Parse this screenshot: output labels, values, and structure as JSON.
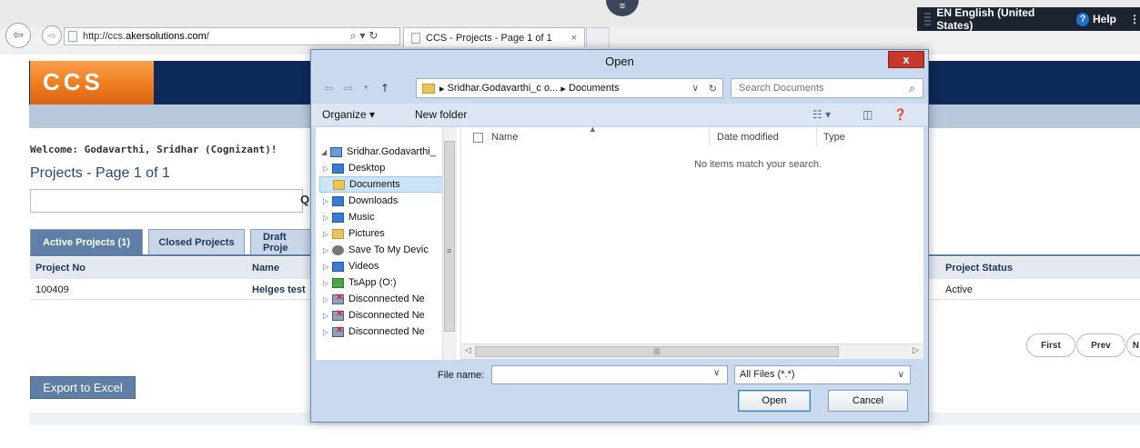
{
  "browser": {
    "address_prefix": "http://ccs.",
    "address_host": "akersolutions.com",
    "address_suffix": "/",
    "address_tools": "⌕ ▾ ↻",
    "tab_title": "CCS - Projects - Page 1 of 1",
    "tab_close": "×",
    "language": "EN English (United States)",
    "help_label": "Help",
    "help_icon": "?",
    "menu_dots": "⋮"
  },
  "app": {
    "logo": "CCS",
    "welcome_label": "Welcome:",
    "welcome_user": "Godavarthi, Sridhar (Cognizant)!",
    "page_title": "Projects - Page 1 of 1",
    "search_icon_glyph": "Q",
    "tabs": [
      {
        "label": "Active Projects (1)"
      },
      {
        "label": "Closed Projects"
      },
      {
        "label": "Draft Proje"
      }
    ],
    "table": {
      "headers": [
        "Project No",
        "Name",
        "Project Status"
      ],
      "rows": [
        {
          "project_no": "100409",
          "name": "Helges test",
          "status": "Active"
        }
      ]
    },
    "pager": [
      "First",
      "Prev",
      "N"
    ],
    "export_label": "Export to Excel"
  },
  "dialog": {
    "title": "Open",
    "close_label": "x",
    "path_user": "Sridhar.Godavarthi_c o...",
    "path_folder": "Documents",
    "path_sep": "▸",
    "search_placeholder": "Search Documents",
    "organize_label": "Organize ▾",
    "new_folder_label": "New folder",
    "tree": [
      {
        "label": "Sridhar.Godavarthi_",
        "icon": "pc-icon",
        "arrow": "◢"
      },
      {
        "label": "Desktop",
        "icon": "folder-blue-icon",
        "arrow": "▷"
      },
      {
        "label": "Documents",
        "icon": "folder-icon",
        "arrow": ""
      },
      {
        "label": "Downloads",
        "icon": "download-folder-icon",
        "arrow": "▷"
      },
      {
        "label": "Music",
        "icon": "music-folder-icon",
        "arrow": "▷"
      },
      {
        "label": "Pictures",
        "icon": "pictures-folder-icon",
        "arrow": "▷"
      },
      {
        "label": "Save To My Devic",
        "icon": "device-icon",
        "arrow": "▷"
      },
      {
        "label": "Videos",
        "icon": "videos-folder-icon",
        "arrow": "▷"
      },
      {
        "label": "TsApp (O:)",
        "icon": "network-drive-icon",
        "arrow": "▷"
      },
      {
        "label": "Disconnected Ne",
        "icon": "disconnected-drive-icon",
        "arrow": "▷"
      },
      {
        "label": "Disconnected Ne",
        "icon": "disconnected-drive-icon",
        "arrow": "▷"
      },
      {
        "label": "Disconnected Ne",
        "icon": "disconnected-drive-icon",
        "arrow": "▷"
      }
    ],
    "columns": [
      "Name",
      "Date modified",
      "Type"
    ],
    "empty_message": "No items match your search.",
    "filename_label": "File name:",
    "filename_value": "",
    "filetype": "All Files (*.*)",
    "open_label": "Open",
    "cancel_label": "Cancel"
  }
}
